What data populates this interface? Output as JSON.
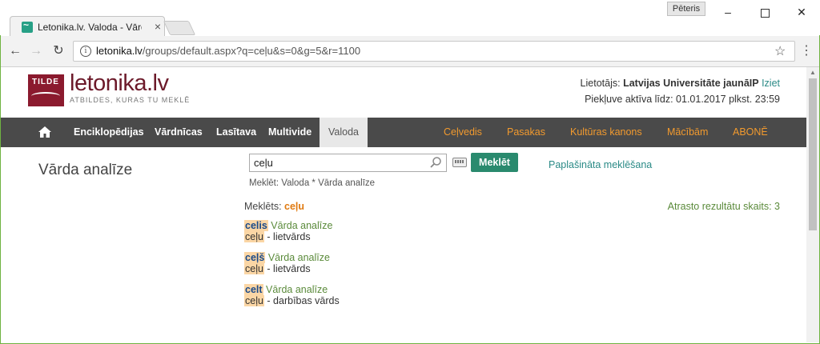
{
  "browser": {
    "tab_title": "Letonika.lv. Valoda - Vārd",
    "tab_close": "×",
    "profile": "Pēteris",
    "win_min": "–",
    "win_close": "✕",
    "url_host": "letonika.lv",
    "url_path": "/groups/default.aspx?q=ceļu&s=0&g=5&r=1100"
  },
  "header": {
    "logo_box": "TILDE",
    "logo_name": "letonika.lv",
    "tagline": "ATBILDES, KURAS TU MEKLĒ",
    "user_label": "Lietotājs: ",
    "user_name": "Latvijas Universitāte jaunāIP",
    "logout": "Iziet",
    "access": "Piekļuve aktīva līdz: 01.01.2017 plkst. 23:59"
  },
  "nav": {
    "items": [
      "Enciklopēdijas",
      "Vārdnīcas",
      "Lasītava",
      "Multivide",
      "Valoda"
    ],
    "orange_items": [
      "Ceļvedis",
      "Pasakas",
      "Kultūras kanons",
      "Mācībām",
      "ABONĒ"
    ]
  },
  "main": {
    "title": "Vārda analīze",
    "search_value": "ceļu",
    "search_button": "Meklēt",
    "advanced": "Paplašināta meklēšana",
    "scope": "Meklēt: Valoda * Vārda analīze",
    "searched_label": "Meklēts: ",
    "searched_term": "ceļu",
    "count": "Atrasto rezultātu skaits: 3",
    "results": [
      {
        "word": "celis",
        "type": "Vārda analīze",
        "form": "ceļu",
        "desc": " - lietvārds"
      },
      {
        "word": "ceļš",
        "type": "Vārda analīze",
        "form": "ceļu",
        "desc": " - lietvārds"
      },
      {
        "word": "celt",
        "type": "Vārda analīze",
        "form": "ceļu",
        "desc": " - darbības vārds"
      }
    ]
  },
  "colors": {
    "brand": "#8b1a2e",
    "accent": "#2a8a6e",
    "nav_bg": "#4a4a4a",
    "nav_orange": "#f29a2e"
  }
}
